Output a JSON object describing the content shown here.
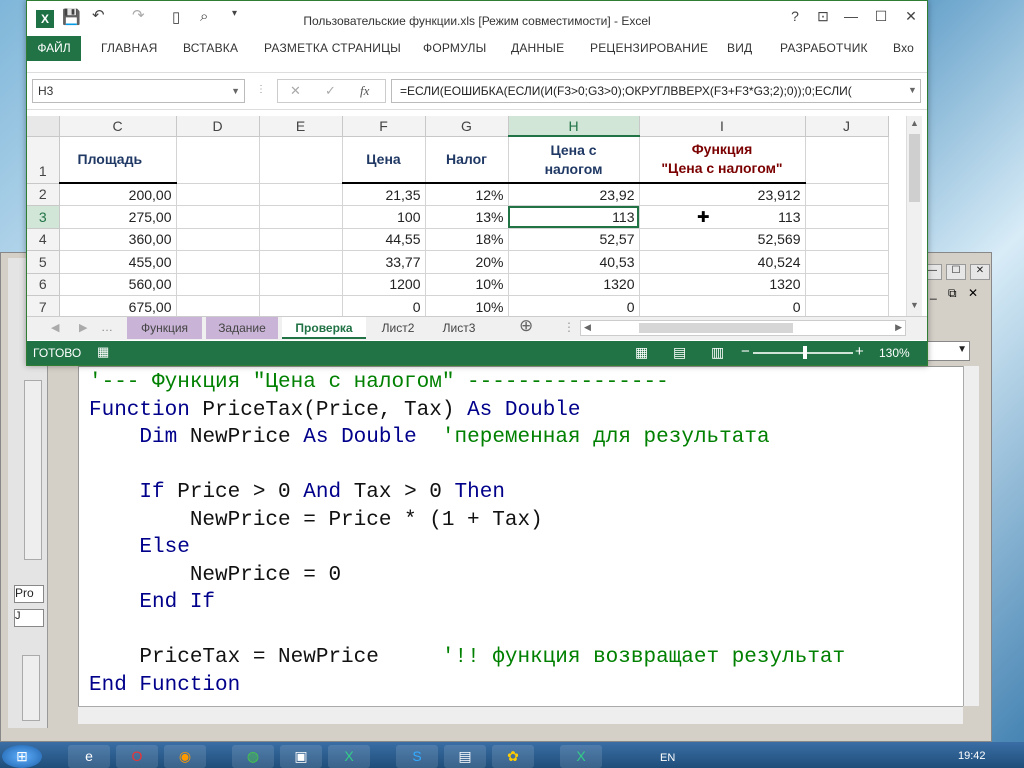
{
  "excel": {
    "title": "Пользовательские функции.xls  [Режим совместимости] - Excel",
    "qa": {
      "save": "💾",
      "undo": "↶",
      "redo": "↷"
    },
    "window_controls": {
      "help": "?",
      "restore": "⊡",
      "minimize": "—",
      "maximize": "☐",
      "close": "✕"
    },
    "ribbon_tabs": [
      "ФАЙЛ",
      "ГЛАВНАЯ",
      "ВСТАВКА",
      "РАЗМЕТКА СТРАНИЦЫ",
      "ФОРМУЛЫ",
      "ДАННЫЕ",
      "РЕЦЕНЗИРОВАНИЕ",
      "ВИД",
      "РАЗРАБОТЧИК",
      "Вхо"
    ],
    "name_box": "H3",
    "fx": "fx",
    "formula": "=ЕСЛИ(ЕОШИБКА(ЕСЛИ(И(F3>0;G3>0);ОКРУГЛВВЕРХ(F3+F3*G3;2);0));0;ЕСЛИ(",
    "columns": [
      "C",
      "D",
      "E",
      "F",
      "G",
      "H",
      "I",
      "J"
    ],
    "header_row": {
      "row": "1",
      "C": "Площадь",
      "F": "Цена",
      "G": "Налог",
      "H1": "Цена с",
      "H2": "налогом",
      "I1": "Функция",
      "I2": "\"Цена с налогом\""
    },
    "rows": [
      {
        "row": "2",
        "C": "200,00",
        "F": "21,35",
        "G": "12%",
        "H": "23,92",
        "I": "23,912"
      },
      {
        "row": "3",
        "C": "275,00",
        "F": "100",
        "G": "13%",
        "H": "113",
        "I": "113"
      },
      {
        "row": "4",
        "C": "360,00",
        "F": "44,55",
        "G": "18%",
        "H": "52,57",
        "I": "52,569"
      },
      {
        "row": "5",
        "C": "455,00",
        "F": "33,77",
        "G": "20%",
        "H": "40,53",
        "I": "40,524"
      },
      {
        "row": "6",
        "C": "560,00",
        "F": "1200",
        "G": "10%",
        "H": "1320",
        "I": "1320"
      },
      {
        "row": "7",
        "C": "675,00",
        "F": "0",
        "G": "10%",
        "H": "0",
        "I": "0"
      }
    ],
    "sheet_tabs": [
      "Функция",
      "Задание",
      "Проверка",
      "Лист2",
      "Лист3"
    ],
    "active_sheet": "Проверка",
    "status": "ГОТОВО",
    "zoom": "130%",
    "colors": {
      "accent": "#217346",
      "header_blue": "#1f3864",
      "header_red": "#7b0000"
    }
  },
  "vbe": {
    "proc_label": "Pro",
    "combo_label": "J",
    "code_lines": [
      {
        "parts": [
          {
            "c": "cm",
            "t": "'--- Функция \"Цена с налогом\" ----------------"
          }
        ]
      },
      {
        "parts": [
          {
            "c": "kw",
            "t": "Function "
          },
          {
            "c": "tx",
            "t": "PriceTax(Price, Tax) "
          },
          {
            "c": "kw",
            "t": "As Double"
          }
        ]
      },
      {
        "parts": [
          {
            "c": "tx",
            "t": "    "
          },
          {
            "c": "kw",
            "t": "Dim "
          },
          {
            "c": "tx",
            "t": "NewPrice "
          },
          {
            "c": "kw",
            "t": "As Double"
          },
          {
            "c": "tx",
            "t": "  "
          },
          {
            "c": "cm",
            "t": "'переменная для результата"
          }
        ]
      },
      {
        "parts": [
          {
            "c": "tx",
            "t": ""
          }
        ]
      },
      {
        "parts": [
          {
            "c": "tx",
            "t": "    "
          },
          {
            "c": "kw",
            "t": "If "
          },
          {
            "c": "tx",
            "t": "Price > 0 "
          },
          {
            "c": "kw",
            "t": "And "
          },
          {
            "c": "tx",
            "t": "Tax > 0 "
          },
          {
            "c": "kw",
            "t": "Then"
          }
        ]
      },
      {
        "parts": [
          {
            "c": "tx",
            "t": "        NewPrice = Price * (1 + Tax)"
          }
        ]
      },
      {
        "parts": [
          {
            "c": "tx",
            "t": "    "
          },
          {
            "c": "kw",
            "t": "Else"
          }
        ]
      },
      {
        "parts": [
          {
            "c": "tx",
            "t": "        NewPrice = 0"
          }
        ]
      },
      {
        "parts": [
          {
            "c": "tx",
            "t": "    "
          },
          {
            "c": "kw",
            "t": "End If"
          }
        ]
      },
      {
        "parts": [
          {
            "c": "tx",
            "t": ""
          }
        ]
      },
      {
        "parts": [
          {
            "c": "tx",
            "t": "    PriceTax = NewPrice     "
          },
          {
            "c": "cm",
            "t": "'!! функция возвращает результат"
          }
        ]
      },
      {
        "parts": [
          {
            "c": "kw",
            "t": "End Function"
          }
        ]
      }
    ]
  },
  "taskbar": {
    "lang": "EN",
    "time": "19:42",
    "apps": [
      "start-icon",
      "ie-icon",
      "opera-icon",
      "firefox-icon",
      "chrome-icon",
      "vbe-icon",
      "excel-icon",
      "skype-icon",
      "notepad-icon",
      "paint-icon",
      "excel2-icon"
    ]
  }
}
